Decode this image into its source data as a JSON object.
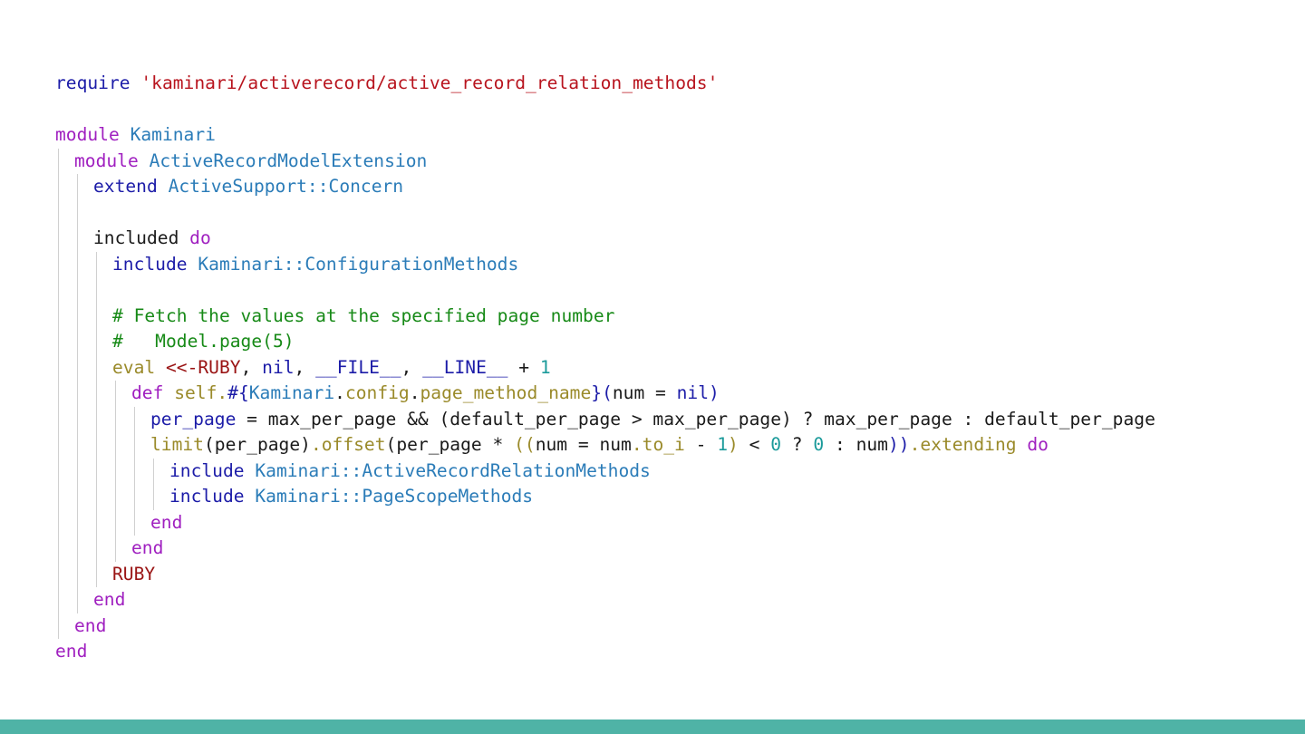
{
  "colors": {
    "text": "#1a1a1a",
    "keyword": "#a020c0",
    "builtin": "#1c1ca8",
    "constant": "#2b7cb8",
    "string": "#b8141e",
    "comment": "#178a17",
    "number": "#1a9a9a",
    "method": "#9a8a2a",
    "heredoc": "#9a1414",
    "footer_bar": "#4fb3a6",
    "indent_guide": "#d0d0d0"
  },
  "code": {
    "lines": [
      {
        "indent": 0,
        "tokens": [
          {
            "t": "require",
            "c": "builtin"
          },
          {
            "t": " ",
            "c": "text"
          },
          {
            "t": "'kaminari/activerecord/active_record_relation_methods'",
            "c": "string"
          }
        ]
      },
      {
        "indent": 0,
        "tokens": []
      },
      {
        "indent": 0,
        "tokens": [
          {
            "t": "module",
            "c": "keyword"
          },
          {
            "t": " ",
            "c": "text"
          },
          {
            "t": "Kaminari",
            "c": "constant"
          }
        ]
      },
      {
        "indent": 1,
        "tokens": [
          {
            "t": "module",
            "c": "keyword"
          },
          {
            "t": " ",
            "c": "text"
          },
          {
            "t": "ActiveRecordModelExtension",
            "c": "constant"
          }
        ]
      },
      {
        "indent": 2,
        "tokens": [
          {
            "t": "extend",
            "c": "builtin"
          },
          {
            "t": " ",
            "c": "text"
          },
          {
            "t": "ActiveSupport::Concern",
            "c": "constant"
          }
        ]
      },
      {
        "indent": 2,
        "tokens": []
      },
      {
        "indent": 2,
        "tokens": [
          {
            "t": "included",
            "c": "text"
          },
          {
            "t": " ",
            "c": "text"
          },
          {
            "t": "do",
            "c": "keyword"
          }
        ]
      },
      {
        "indent": 3,
        "tokens": [
          {
            "t": "include",
            "c": "builtin"
          },
          {
            "t": " ",
            "c": "text"
          },
          {
            "t": "Kaminari::ConfigurationMethods",
            "c": "constant"
          }
        ]
      },
      {
        "indent": 3,
        "tokens": []
      },
      {
        "indent": 3,
        "tokens": [
          {
            "t": "# Fetch the values at the specified page number",
            "c": "comment"
          }
        ]
      },
      {
        "indent": 3,
        "tokens": [
          {
            "t": "#   Model.page(5)",
            "c": "comment"
          }
        ]
      },
      {
        "indent": 3,
        "tokens": [
          {
            "t": "eval",
            "c": "method"
          },
          {
            "t": " ",
            "c": "text"
          },
          {
            "t": "<<-RUBY",
            "c": "heredoc"
          },
          {
            "t": ", ",
            "c": "text"
          },
          {
            "t": "nil",
            "c": "builtin"
          },
          {
            "t": ", ",
            "c": "text"
          },
          {
            "t": "__FILE__",
            "c": "builtin"
          },
          {
            "t": ", ",
            "c": "text"
          },
          {
            "t": "__LINE__",
            "c": "builtin"
          },
          {
            "t": " + ",
            "c": "text"
          },
          {
            "t": "1",
            "c": "number"
          }
        ]
      },
      {
        "indent": 4,
        "tokens": [
          {
            "t": "def",
            "c": "keyword"
          },
          {
            "t": " ",
            "c": "text"
          },
          {
            "t": "self.",
            "c": "method"
          },
          {
            "t": "#{",
            "c": "builtin"
          },
          {
            "t": "Kaminari",
            "c": "constant"
          },
          {
            "t": ".",
            "c": "text"
          },
          {
            "t": "config",
            "c": "method"
          },
          {
            "t": ".",
            "c": "text"
          },
          {
            "t": "page_method_name",
            "c": "method"
          },
          {
            "t": "}",
            "c": "builtin"
          },
          {
            "t": "(",
            "c": "builtin"
          },
          {
            "t": "num = ",
            "c": "text"
          },
          {
            "t": "nil",
            "c": "builtin"
          },
          {
            "t": ")",
            "c": "builtin"
          }
        ]
      },
      {
        "indent": 5,
        "tokens": [
          {
            "t": "per_page",
            "c": "builtin"
          },
          {
            "t": " = max_per_page && (default_per_page > max_per_page) ? max_per_page : default_per_page",
            "c": "text"
          }
        ]
      },
      {
        "indent": 5,
        "tokens": [
          {
            "t": "limit",
            "c": "method"
          },
          {
            "t": "(per_page)",
            "c": "text"
          },
          {
            "t": ".offset",
            "c": "method"
          },
          {
            "t": "(per_page * ",
            "c": "text"
          },
          {
            "t": "((",
            "c": "method"
          },
          {
            "t": "num = num",
            "c": "text"
          },
          {
            "t": ".to_i",
            "c": "method"
          },
          {
            "t": " - ",
            "c": "text"
          },
          {
            "t": "1",
            "c": "number"
          },
          {
            "t": ")",
            "c": "method"
          },
          {
            "t": " < ",
            "c": "text"
          },
          {
            "t": "0",
            "c": "number"
          },
          {
            "t": " ? ",
            "c": "text"
          },
          {
            "t": "0",
            "c": "number"
          },
          {
            "t": " : num",
            "c": "text"
          },
          {
            "t": "))",
            "c": "builtin"
          },
          {
            "t": ".extending",
            "c": "method"
          },
          {
            "t": " ",
            "c": "text"
          },
          {
            "t": "do",
            "c": "keyword"
          }
        ]
      },
      {
        "indent": 6,
        "tokens": [
          {
            "t": "include",
            "c": "builtin"
          },
          {
            "t": " ",
            "c": "text"
          },
          {
            "t": "Kaminari::ActiveRecordRelationMethods",
            "c": "constant"
          }
        ]
      },
      {
        "indent": 6,
        "tokens": [
          {
            "t": "include",
            "c": "builtin"
          },
          {
            "t": " ",
            "c": "text"
          },
          {
            "t": "Kaminari::PageScopeMethods",
            "c": "constant"
          }
        ]
      },
      {
        "indent": 5,
        "tokens": [
          {
            "t": "end",
            "c": "keyword"
          }
        ]
      },
      {
        "indent": 4,
        "tokens": [
          {
            "t": "end",
            "c": "keyword"
          }
        ]
      },
      {
        "indent": 3,
        "tokens": [
          {
            "t": "RUBY",
            "c": "heredoc"
          }
        ]
      },
      {
        "indent": 2,
        "tokens": [
          {
            "t": "end",
            "c": "keyword"
          }
        ]
      },
      {
        "indent": 1,
        "tokens": [
          {
            "t": "end",
            "c": "keyword"
          }
        ]
      },
      {
        "indent": 0,
        "tokens": [
          {
            "t": "end",
            "c": "keyword"
          }
        ]
      }
    ]
  }
}
